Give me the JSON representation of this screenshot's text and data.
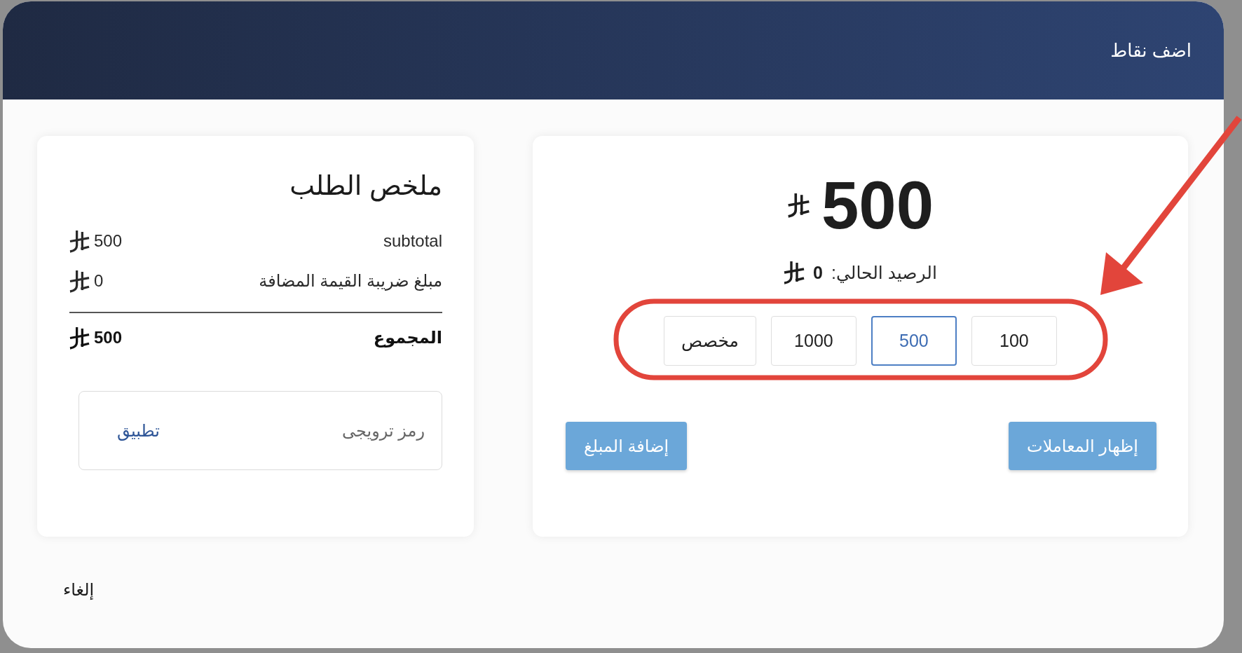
{
  "dialog": {
    "title": "اضف نقاط"
  },
  "amount_card": {
    "amount": "500",
    "balance_label": "الرصيد الحالي:",
    "balance_value": "0",
    "presets": [
      {
        "label": "100",
        "selected": false
      },
      {
        "label": "500",
        "selected": true
      },
      {
        "label": "1000",
        "selected": false
      },
      {
        "label": "مخصص",
        "selected": false
      }
    ],
    "buttons": [
      "إظهار المعاملات",
      "إضافة المبلغ"
    ]
  },
  "order_summary": {
    "title": "ملخص الطلب",
    "rows": [
      {
        "kind": "item",
        "label": "subtotal",
        "value": "500"
      },
      {
        "kind": "item",
        "label": "مبلغ ضريبة القيمة المضافة",
        "value": "0"
      },
      {
        "kind": "total",
        "label": "المجموع",
        "value": "500"
      }
    ],
    "promo": {
      "placeholder": "رمز ترويجى",
      "apply": "تطبيق"
    }
  },
  "footer": {
    "cancel": "إلغاء"
  },
  "annotation": {
    "visible": true
  }
}
